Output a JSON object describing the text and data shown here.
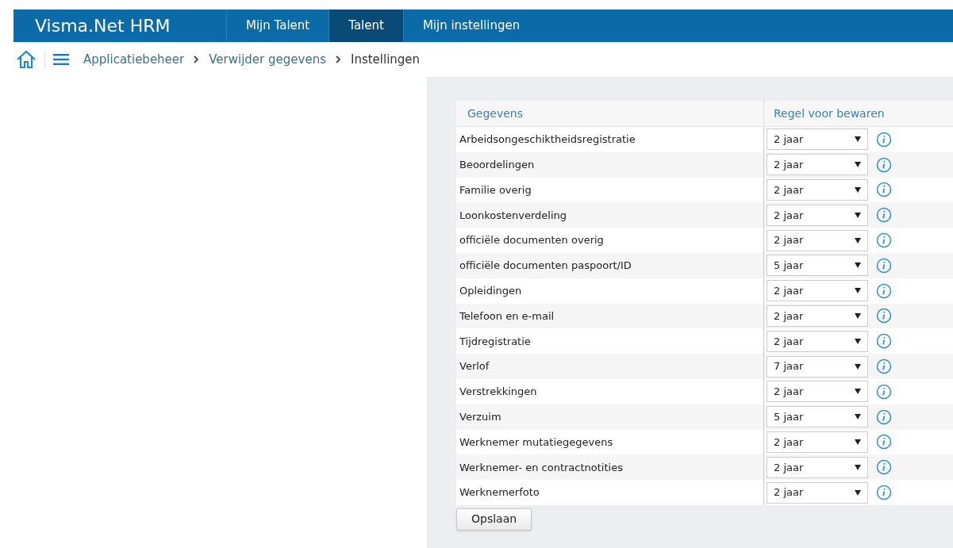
{
  "app": {
    "title": "Visma.Net HRM"
  },
  "tabs": [
    {
      "label": "Mijn Talent",
      "selected": false
    },
    {
      "label": "Talent",
      "selected": true
    },
    {
      "label": "Mijn instellingen",
      "selected": false
    }
  ],
  "breadcrumb": [
    "Applicatiebeheer",
    "Verwijder gegevens",
    "Instellingen"
  ],
  "table": {
    "columns": [
      "Gegevens",
      "Regel voor bewaren"
    ],
    "rows": [
      {
        "name": "Arbeidsongeschiktheidsregistratie",
        "rule": "2 jaar"
      },
      {
        "name": "Beoordelingen",
        "rule": "2 jaar"
      },
      {
        "name": "Familie overig",
        "rule": "2 jaar"
      },
      {
        "name": "Loonkostenverdeling",
        "rule": "2 jaar"
      },
      {
        "name": "officiële documenten overig",
        "rule": "2 jaar"
      },
      {
        "name": "officiële documenten paspoort/ID",
        "rule": "5 jaar"
      },
      {
        "name": "Opleidingen",
        "rule": "2 jaar"
      },
      {
        "name": "Telefoon en e-mail",
        "rule": "2 jaar"
      },
      {
        "name": "Tijdregistratie",
        "rule": "2 jaar"
      },
      {
        "name": "Verlof",
        "rule": "7 jaar"
      },
      {
        "name": "Verstrekkingen",
        "rule": "2 jaar"
      },
      {
        "name": "Verzuim",
        "rule": "5 jaar"
      },
      {
        "name": "Werknemer mutatiegegevens",
        "rule": "2 jaar"
      },
      {
        "name": "Werknemer- en contractnotities",
        "rule": "2 jaar"
      },
      {
        "name": "Werknemerfoto",
        "rule": "2 jaar"
      }
    ]
  },
  "buttons": [
    "Opslaan"
  ]
}
